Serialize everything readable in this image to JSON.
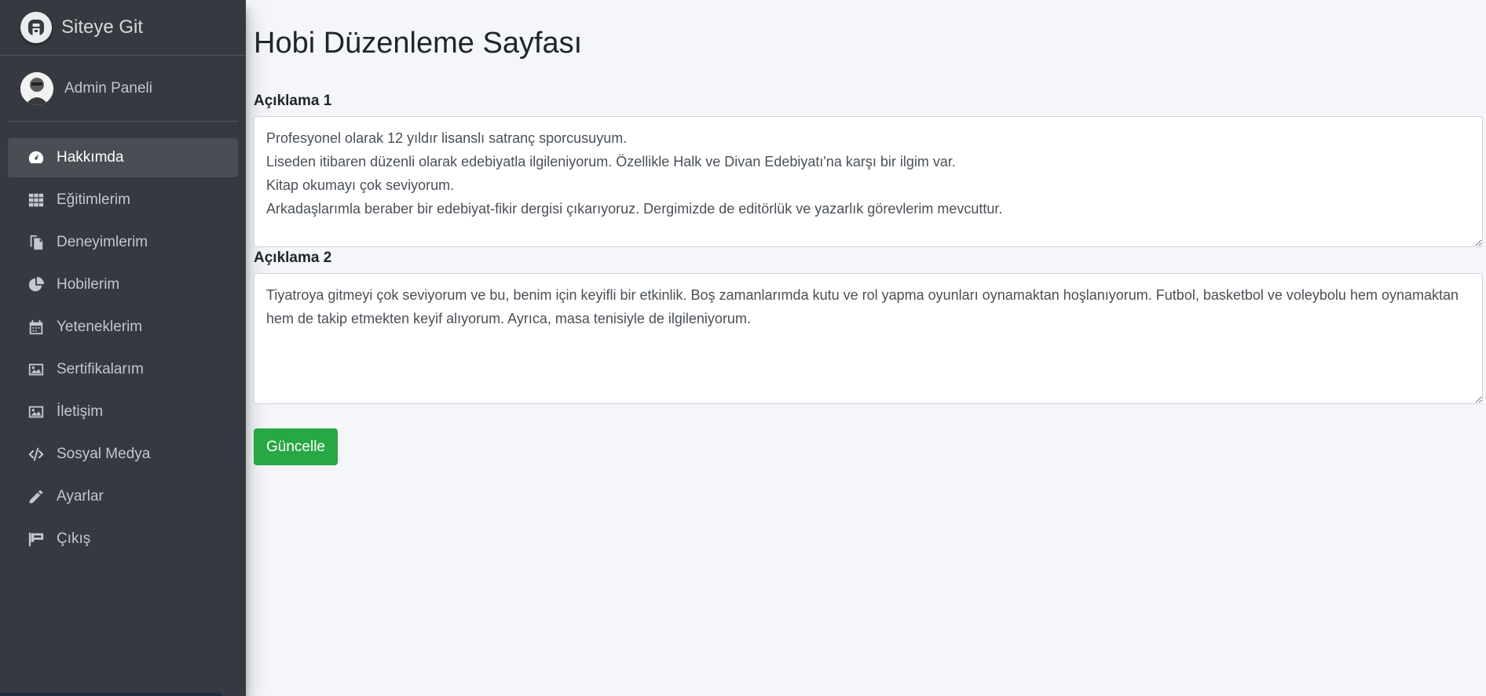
{
  "brand": {
    "text": "Siteye Git",
    "logo_icon": "adminlte-logo-icon"
  },
  "user": {
    "name": "Admin Paneli",
    "avatar_icon": "user-avatar"
  },
  "nav": [
    {
      "label": "Hakkımda",
      "icon": "tachometer-icon",
      "active": true
    },
    {
      "label": "Eğitimlerim",
      "icon": "grid-icon"
    },
    {
      "label": "Deneyimlerim",
      "icon": "copy-icon"
    },
    {
      "label": "Hobilerim",
      "icon": "pie-chart-icon"
    },
    {
      "label": "Yeteneklerim",
      "icon": "calendar-icon"
    },
    {
      "label": "Sertifikalarım",
      "icon": "image-icon"
    },
    {
      "label": "İletişim",
      "icon": "image-icon"
    },
    {
      "label": "Sosyal Medya",
      "icon": "code-icon"
    },
    {
      "label": "Ayarlar",
      "icon": "pencil-icon"
    },
    {
      "label": "Çıkış",
      "icon": "flag-icon"
    }
  ],
  "main": {
    "title": "Hobi Düzenleme Sayfası",
    "field1": {
      "label": "Açıklama 1",
      "value": "Profesyonel olarak 12 yıldır lisanslı satranç sporcusuyum.\nLiseden itibaren düzenli olarak edebiyatla ilgileniyorum. Özellikle Halk ve Divan Edebiyatı'na karşı bir ilgim var.\nKitap okumayı çok seviyorum.\nArkadaşlarımla beraber bir edebiyat-fikir dergisi çıkarıyoruz. Dergimizde de editörlük ve yazarlık görevlerim mevcuttur."
    },
    "field2": {
      "label": "Açıklama 2",
      "value": "Tiyatroya gitmeyi çok seviyorum ve bu, benim için keyifli bir etkinlik. Boş zamanlarımda kutu ve rol yapma oyunları oynamaktan hoşlanıyorum. Futbol, basketbol ve voleybolu hem oynamaktan hem de takip etmekten keyif alıyorum. Ayrıca, masa tenisiyle de ilgileniyorum."
    },
    "submit_label": "Güncelle"
  },
  "colors": {
    "sidebar": "#343a40",
    "accent": "#28a745",
    "background": "#f4f6f9"
  }
}
